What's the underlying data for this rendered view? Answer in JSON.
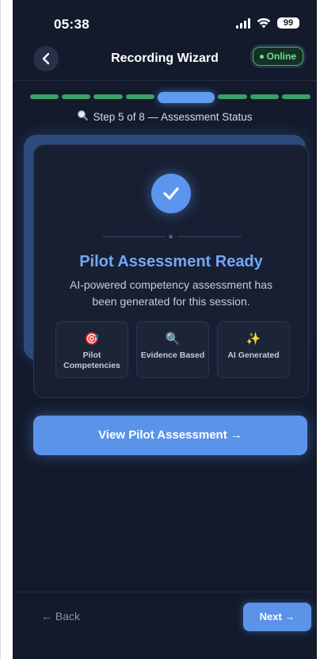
{
  "status_bar": {
    "time": "05:38",
    "battery": "99"
  },
  "nav": {
    "title": "Recording Wizard",
    "online_label": "Online"
  },
  "progress": {
    "current_step": 5,
    "total_steps": 8,
    "label": "Step 5 of 8 — Assessment Status"
  },
  "card": {
    "title": "Pilot Assessment Ready",
    "description": "AI-powered competency assessment has been generated for this session.",
    "features": [
      {
        "icon": "target-icon",
        "glyph": "🎯",
        "label": "Pilot Competencies"
      },
      {
        "icon": "magnifier-icon",
        "glyph": "🔍",
        "label": "Evidence Based"
      },
      {
        "icon": "sparkles-icon",
        "glyph": "✨",
        "label": "AI Generated"
      }
    ]
  },
  "actions": {
    "view_assessment": "View Pilot Assessment →",
    "back": "← Back",
    "next": "Next →"
  },
  "colors": {
    "background": "#131a2c",
    "accent": "#5b93e8",
    "title": "#72a8f4",
    "online": "#6fe08e",
    "progress_done": "#3f9d67"
  }
}
